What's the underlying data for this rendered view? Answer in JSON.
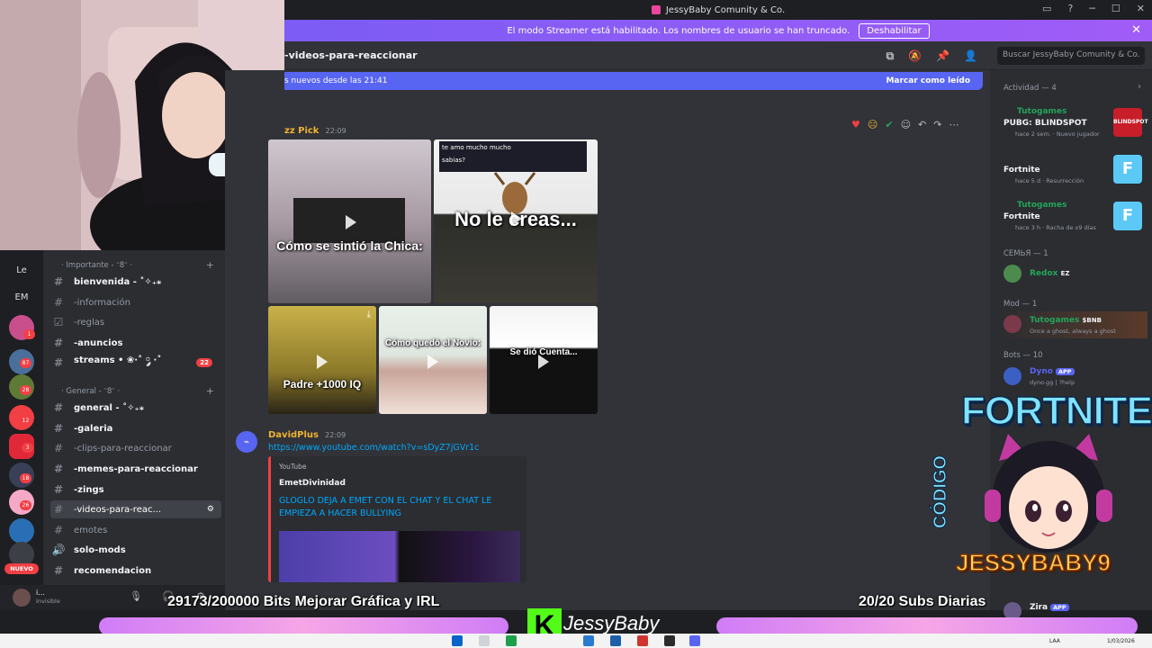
{
  "window": {
    "title": "JessyBaby Comunity & Co."
  },
  "banner": {
    "text": "El modo Streamer está habilitado. Los nombres de usuario se han truncado.",
    "button": "Deshabilitar"
  },
  "channel": {
    "name": "-videos-para-reaccionar"
  },
  "search": {
    "placeholder": "Buscar JessyBaby Comunity & Co."
  },
  "new_messages": {
    "text": "s nuevos desde las 21:41",
    "mark_read": "Marcar como leído"
  },
  "messages": [
    {
      "author": "zz Pick",
      "time": "22:09",
      "captions": [
        "Cómo se sintió la Chica:",
        "No le creas...",
        "Padre +1000 IQ",
        "Cómo quedó el Novio:",
        "Se dió Cuenta..."
      ],
      "chat_bubble_1": "te amo mucho mucho",
      "chat_bubble_2": "sabias?"
    },
    {
      "author": "DavidPlus",
      "time": "22:09",
      "link": "https://www.youtube.com/watch?v=sDyZ7jGVr1c",
      "embed": {
        "provider": "YouTube",
        "author": "EmetDivinidad",
        "title": "GLOGLO DEJA A EMET CON EL CHAT Y EL CHAT LE EMPIEZA A HACER BULLYING"
      }
    }
  ],
  "sidebar": {
    "categories": [
      {
        "label": "· Importante - ᵔ8ᵔ ·"
      },
      {
        "label": "· General - ᵔ8ᵔ ·"
      }
    ],
    "channels": [
      {
        "label": "bienvenida - ˚✧₊⁎"
      },
      {
        "label": "-información"
      },
      {
        "label": "-reglas"
      },
      {
        "label": "-anuncios"
      },
      {
        "label": "streams • ❀·˚ ༘ ·˚",
        "count": "22"
      },
      {
        "label": "general - ˚✧₊⁎"
      },
      {
        "label": "-galeria"
      },
      {
        "label": "-clips-para-reaccionar"
      },
      {
        "label": "-memes-para-reaccionar"
      },
      {
        "label": "-zings"
      },
      {
        "label": "-videos-para-reac..."
      },
      {
        "label": "emotes"
      },
      {
        "label": "solo-mods"
      },
      {
        "label": "recomendacion"
      }
    ],
    "servers": [
      {
        "label": "Le"
      },
      {
        "label": "EM"
      }
    ],
    "badges": [
      "1",
      "87",
      "28",
      "12",
      "3",
      "18",
      "26"
    ],
    "nuevo": "NUEVO",
    "user": {
      "name": "i...",
      "status": "Invisible"
    }
  },
  "members": {
    "activity_header": "Actividad — 4",
    "activities": [
      {
        "user": "Tutogames",
        "game": "PUBG: BLINDSPOT",
        "meta": "hace 2 sem. · Nuevo jugador",
        "icon_text": "BLINDSPOT"
      },
      {
        "user": "",
        "game": "Fortnite",
        "meta": "hace 5 d · Resurrección",
        "icon_text": "F"
      },
      {
        "user": "Tutogames",
        "game": "Fortnite",
        "meta": "hace 3 h · Racha de x9 días",
        "icon_text": "F"
      }
    ],
    "groups": [
      {
        "label": "СЕМЬЯ — 1",
        "name": "Redox",
        "tag": "EZ"
      },
      {
        "label": "Mod — 1",
        "name": "Tutogames",
        "tag": "$BNB",
        "sub": "Once a ghost, always a ghost"
      },
      {
        "label": "Bots — 10",
        "name": "Dyno",
        "tag": "APP",
        "sub": "dyno.gg | ?help"
      }
    ],
    "last": {
      "name": "Zira",
      "tag": "APP"
    }
  },
  "overlay": {
    "fortnite": "FORTNITE",
    "codigo": "CÓDIGO",
    "creator": "JESSYBABY9",
    "bits": "29173/200000 Bits Mejorar Gráfica y IRL",
    "subs": "20/20 Subs Diarias",
    "kick": "JessyBaby"
  },
  "taskbar": {
    "lang": "LAA",
    "date": "1/03/2026"
  },
  "colors": {
    "accent": "#5865f2",
    "banner": "#8f5cf6",
    "danger": "#f23f43",
    "link": "#00a8fc",
    "member_green": "#23a55a",
    "kick": "#53fc18"
  }
}
